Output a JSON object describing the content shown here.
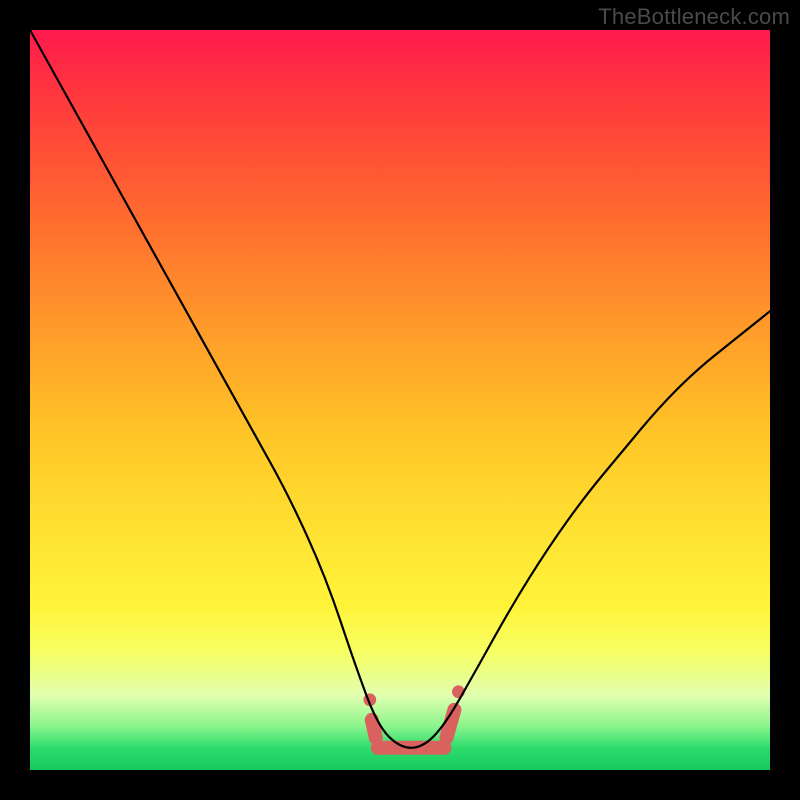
{
  "watermark": "TheBottleneck.com",
  "chart_data": {
    "type": "line",
    "title": "",
    "xlabel": "",
    "ylabel": "",
    "xlim": [
      0,
      100
    ],
    "ylim": [
      0,
      100
    ],
    "series": [
      {
        "name": "bottleneck-curve",
        "x": [
          0,
          5,
          10,
          15,
          20,
          25,
          30,
          35,
          40,
          44,
          47,
          50,
          53,
          56,
          60,
          65,
          70,
          75,
          80,
          85,
          90,
          95,
          100
        ],
        "y": [
          100,
          91,
          82,
          73,
          64,
          55,
          46,
          37,
          26,
          14,
          6,
          3,
          3,
          6,
          13,
          22,
          30,
          37,
          43,
          49,
          54,
          58,
          62
        ]
      }
    ],
    "flat_segment": {
      "x_start": 47,
      "x_end": 56,
      "color": "#d9625e",
      "thickness": 14
    },
    "curve_style": {
      "color": "#000000",
      "thickness": 2.2
    }
  }
}
